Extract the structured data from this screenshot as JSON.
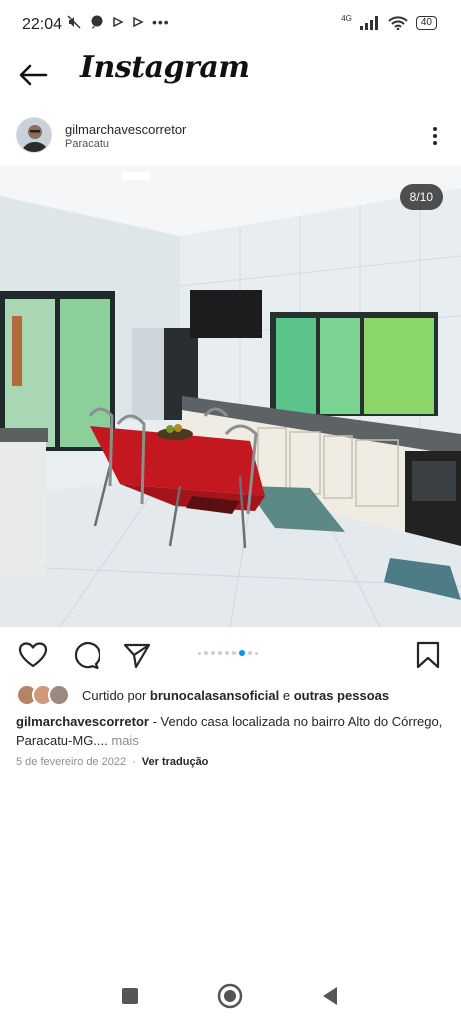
{
  "status_bar": {
    "time": "22:04",
    "network_label": "4G",
    "battery": "40"
  },
  "header": {
    "title": "Instagram"
  },
  "post": {
    "username": "gilmarchavescorretor",
    "location": "Paracatu",
    "photo_counter": "8/10",
    "carousel_total_dots": 9,
    "carousel_active_dot": 7
  },
  "likes": {
    "prefix": "Curtido por ",
    "user": "brunocalasansoficial",
    "middle": " e ",
    "others": "outras pessoas"
  },
  "caption": {
    "username": "gilmarchavescorretor",
    "text": " - Vendo casa localizada no bairro Alto do Córrego, Paracatu-MG....",
    "more": "mais"
  },
  "meta": {
    "date": "5 de fevereiro de 2022",
    "separator": "·",
    "translate": "Ver tradução"
  },
  "icons": {
    "back": "arrow-left-icon",
    "more": "more-vertical-icon",
    "like": "heart-icon",
    "comment": "comment-icon",
    "share": "send-icon",
    "save": "bookmark-icon",
    "nav_recents": "square-icon",
    "nav_home": "circle-icon",
    "nav_back": "triangle-back-icon"
  },
  "colors": {
    "accent": "#0095f6",
    "text": "#262626",
    "muted": "#8e8e8e"
  }
}
